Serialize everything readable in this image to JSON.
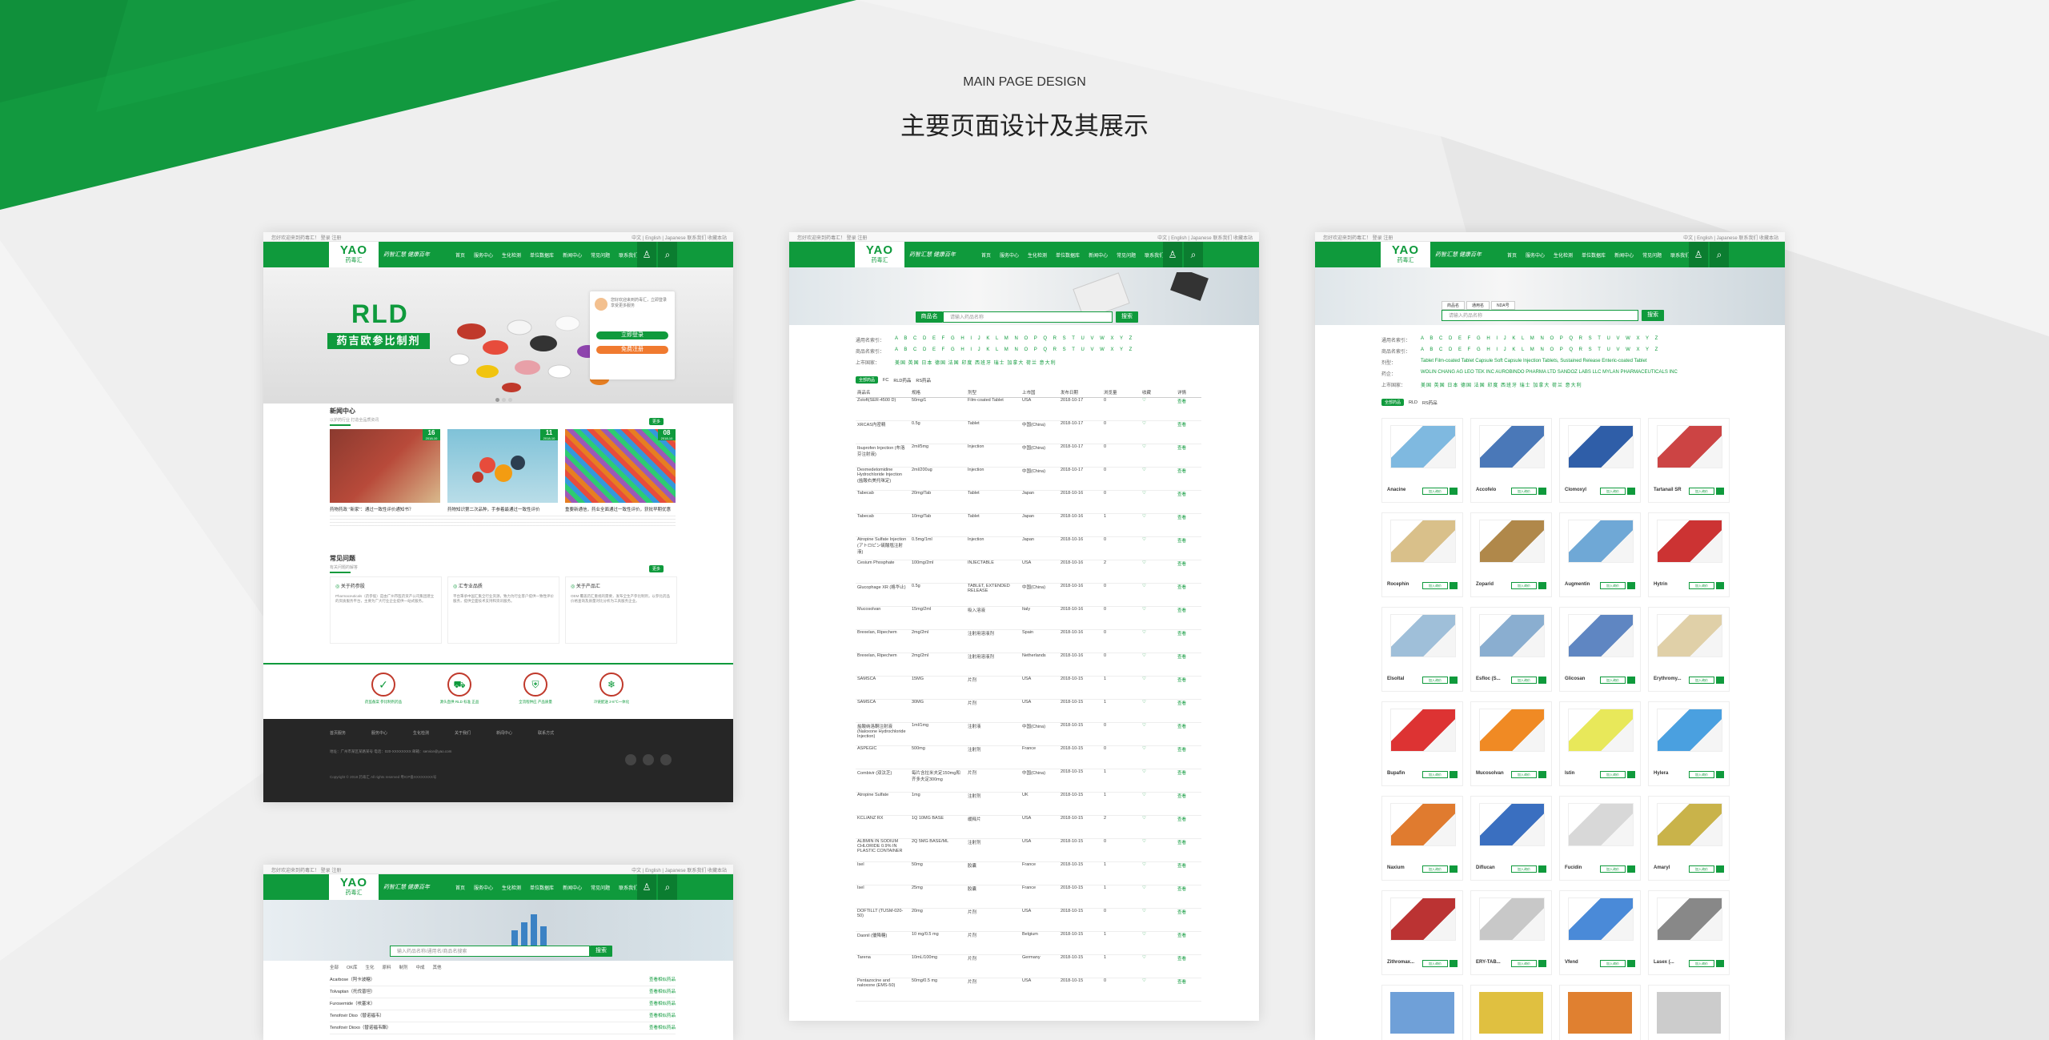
{
  "header": {
    "title_en": "MAIN PAGE DESIGN",
    "title_zh": "主要页面设计及其展示"
  },
  "site": {
    "logo_text": "YAO",
    "logo_sub": "药毒汇",
    "slogan": "药智汇慧 健康百年",
    "topbar_left": "您好欢迎来到药毒汇！ 登录  注册",
    "topbar_right": "中文 | English | Japanese   联系我们   收藏本站",
    "nav_items": [
      "首页",
      "服务中心",
      "生化检测",
      "单位数据库",
      "新闻中心",
      "常见问题",
      "联系我们"
    ],
    "accent": "#0f9a3c",
    "dark_footer": "#262626"
  },
  "home": {
    "banner_title": "RLD",
    "banner_subtitle": "药吉欧参比制剂",
    "login_hint": "您好欢迎来到药毒汇，立即登录享受更多服务",
    "login_btn": "立即登录",
    "register_btn": "免费注册",
    "news_title": "新闻中心",
    "news_sub": "以护药行业  打造全品质资讯",
    "more": "更多",
    "news": [
      {
        "day": "16",
        "date": "2018-10",
        "text": "药物药政 \"新家\"：通过一致性评价通知书？"
      },
      {
        "day": "11",
        "date": "2018-10",
        "text": "药物知识第二次品种，手参着最通过一致性评价"
      },
      {
        "day": "08",
        "date": "2018-10",
        "text": "重要新通信，药业全面通过一致性评价，获批早期优惠"
      }
    ],
    "faq_title": "常见问题",
    "faq_sub": "有关问题的解答",
    "faq": [
      {
        "q": "关于药参股",
        "a": "Pharmaceuticals（药参股）是由广州市医药资产公司集团建立的资质服务平台，主要为广大行业企业提供一站式服务。"
      },
      {
        "q": "汇专业品质",
        "a": "平台秉承中国汇集全行业资源，致力为行业客户提供一致性评价服务，提供全面技术支持和资讯服务。"
      },
      {
        "q": "关于产品汇",
        "a": "OEM 覆盖药汇重视的需要，发布全生产参比制剂，以参比药品价格查询及质量对比分析为工具服务企业。"
      }
    ],
    "features": [
      "药监备案 参比制剂药品",
      "源头直供 RLD 标准 正品",
      "全流程供应 产品质量",
      "冷链配送 2-8℃一体化"
    ],
    "footer_links": [
      "首页服务",
      "服务中心",
      "生化检测",
      "关于我们",
      "新闻中心",
      "联系方式"
    ],
    "footer_info": "地址：广州市某区某路某号  电话：020-XXXXXXXX  邮箱：service@yao.com",
    "footer_copy": "Copyright © 2018 药毒汇 All rights reserved  粤ICP备XXXXXXXX号"
  },
  "search_page": {
    "search_placeholder": "输入药品名称/通用名/商品名搜索",
    "search_btn": "搜索",
    "filter_tabs": [
      "全部",
      "OK库",
      "生化",
      "原料",
      "制剂",
      "中成",
      "其他"
    ],
    "rows": [
      {
        "name": "Acarbose（阿卡波糖）",
        "link": "查看相似药品"
      },
      {
        "name": "Tolvaptan（托伐普坦）",
        "link": "查看相似药品"
      },
      {
        "name": "Furosemide（呋塞米）",
        "link": "查看相似药品"
      },
      {
        "name": "Tenofovir Diso（替诺福韦）",
        "link": "查看相似药品"
      },
      {
        "name": "Tenofovir Dioxo（替诺福韦酯）",
        "link": "查看相似药品"
      }
    ]
  },
  "list_page": {
    "search_select": "商品名",
    "search_placeholder": "请输入药品名称",
    "search_btn": "搜索",
    "filter_labels": [
      "通用名索引：",
      "商品名索引：",
      "上市国家："
    ],
    "alphabet": "A B C D E F G H I J K L M N O P Q R S T U V W X Y Z",
    "countries": "美国 英国 日本 德国 法国 印度 西班牙 瑞士 加拿大 荷兰 意大利",
    "tabs": [
      "全部药品",
      "FC",
      "RLD药品",
      "RS药品"
    ],
    "columns": [
      "商品名",
      "规格",
      "剂型",
      "上市国",
      "发布日期",
      "浏览量",
      "收藏",
      "详情"
    ],
    "rows": [
      [
        "Zoloft(SER-4500 D)",
        "50mg/1",
        "Film-coated Tablet",
        "USA",
        "2018-10-17",
        "0",
        "♡",
        "查看"
      ],
      [
        "XRCAS内密精",
        "0.5g",
        "Tablet",
        "中国(China)",
        "2018-10-17",
        "0",
        "♡",
        "查看"
      ],
      [
        "Ibuprofen Injection (布洛芬注射液)",
        "2ml/5mg",
        "Injection",
        "中国(China)",
        "2018-10-17",
        "0",
        "♡",
        "查看"
      ],
      [
        "Dexmedetomidine Hydrochloride Injection (盐酸右美托咪定)",
        "2ml/200ug",
        "Injection",
        "中国(China)",
        "2018-10-17",
        "0",
        "♡",
        "查看"
      ],
      [
        "Tabecab",
        "20mg/Tab",
        "Tablet",
        "Japan",
        "2018-10-16",
        "0",
        "♡",
        "查看"
      ],
      [
        "Tabecab",
        "10mg/Tab",
        "Tablet",
        "Japan",
        "2018-10-16",
        "1",
        "♡",
        "查看"
      ],
      [
        "Atropine Sulfate Injection (アトロピン硫酸塩注射液)",
        "0.5mg/1ml",
        "Injection",
        "Japan",
        "2018-10-16",
        "0",
        "♡",
        "查看"
      ],
      [
        "Cesium Phosphate",
        "100mg/2ml",
        "INJECTABLE",
        "USA",
        "2018-10-16",
        "2",
        "♡",
        "查看"
      ],
      [
        "Glucophage XR (格华止)",
        "0.5g",
        "TABLET, EXTENDED RELEASE",
        "中国(China)",
        "2018-10-16",
        "0",
        "♡",
        "查看"
      ],
      [
        "Mucosolvan",
        "15mg/2ml",
        "吸入溶液",
        "Italy",
        "2018-10-16",
        "0",
        "♡",
        "查看"
      ],
      [
        "Brexelan, Ripechem",
        "2mg/2ml",
        "注射用溶液剂",
        "Spain",
        "2018-10-16",
        "0",
        "♡",
        "查看"
      ],
      [
        "Brexelan, Ripechem",
        "2mg/2ml",
        "注射用溶液剂",
        "Netherlands",
        "2018-10-16",
        "0",
        "♡",
        "查看"
      ],
      [
        "SAMSCA",
        "15MG",
        "片剂",
        "USA",
        "2018-10-15",
        "1",
        "♡",
        "查看"
      ],
      [
        "SAMSCA",
        "30MG",
        "片剂",
        "USA",
        "2018-10-15",
        "1",
        "♡",
        "查看"
      ],
      [
        "盐酸纳洛酮注射液(Naloxone Hydrochloride Injection)",
        "1ml/1mg",
        "注射液",
        "中国(China)",
        "2018-10-15",
        "0",
        "♡",
        "查看"
      ],
      [
        "ASPEGIC",
        "500mg",
        "注射剂",
        "France",
        "2018-10-15",
        "0",
        "♡",
        "查看"
      ],
      [
        "Combivir (双汰芝)",
        "每片含拉米夫定150mg和齐多夫定300mg",
        "片剂",
        "中国(China)",
        "2018-10-15",
        "1",
        "♡",
        "查看"
      ],
      [
        "Atropine Sulfate",
        "1mg",
        "注射剂",
        "UK",
        "2018-10-15",
        "1",
        "♡",
        "查看"
      ],
      [
        "KCL/ANZ RX",
        "1Q 10MG BASE",
        "缓释片",
        "USA",
        "2018-10-15",
        "2",
        "♡",
        "查看"
      ],
      [
        "ALBMIN IN SODIUM CHLORIDE 0.9% IN PLASTIC CONTAINER",
        "2Q 5MG BASE/ML",
        "注射剂",
        "USA",
        "2018-10-15",
        "0",
        "♡",
        "查看"
      ],
      [
        "Isel",
        "50mg",
        "胶囊",
        "France",
        "2018-10-15",
        "1",
        "♡",
        "查看"
      ],
      [
        "Isel",
        "25mg",
        "胶囊",
        "France",
        "2018-10-15",
        "1",
        "♡",
        "查看"
      ],
      [
        "DOFTILLT (TUSM-020-50)",
        "20mg",
        "片剂",
        "USA",
        "2018-10-15",
        "0",
        "♡",
        "查看"
      ],
      [
        "Daonil (優降糖)",
        "10 mg/0.5 mg",
        "片剂",
        "Belgium",
        "2018-10-15",
        "1",
        "♡",
        "查看"
      ],
      [
        "Tarena",
        "10mL/100mg",
        "片剂",
        "Germany",
        "2018-10-15",
        "1",
        "♡",
        "查看"
      ],
      [
        "Pentazocine and naloxone (EMS-50)",
        "50mg/0.5 mg",
        "片剂",
        "USA",
        "2018-10-15",
        "0",
        "♡",
        "查看"
      ]
    ]
  },
  "product_page": {
    "search_tabs": [
      "商品名",
      "通用名",
      "NDA号"
    ],
    "search_placeholder": "请输入药品名称",
    "search_btn": "搜索",
    "filter_labels": [
      "通用名索引：",
      "商品名索引：",
      "剂型：",
      "药企：",
      "上市国家："
    ],
    "dosage_forms": "Tablet  Film-coated Tablet  Capsule  Soft Capsule  Injection  Tablets, Sustained Release  Enteric-coated Tablet",
    "companies": "WOLIN CHANG AG  LEO TEK INC  AUROBINDO PHARMA LTD  SANDOZ LABS LLC  MYLAN PHARMACEUTICALS INC",
    "tabs": [
      "全部药品",
      "RLD",
      "RS药品"
    ],
    "cart_btn": "加入询价",
    "products": [
      {
        "name": "Anacine"
      },
      {
        "name": "Accofelo"
      },
      {
        "name": "Clomoxyl"
      },
      {
        "name": "Tartanail SR"
      },
      {
        "name": "Rocephin"
      },
      {
        "name": "Zoparid"
      },
      {
        "name": "Augmentin"
      },
      {
        "name": "Hytrin"
      },
      {
        "name": "Elsoltal"
      },
      {
        "name": "Esfloc (S..."
      },
      {
        "name": "Glicosan"
      },
      {
        "name": "Erythromy..."
      },
      {
        "name": "Bupafin"
      },
      {
        "name": "Mucosolvan"
      },
      {
        "name": "Istin"
      },
      {
        "name": "Hylera"
      },
      {
        "name": "Naxium"
      },
      {
        "name": "Diflucan"
      },
      {
        "name": "Fucidin"
      },
      {
        "name": "Amaryl"
      },
      {
        "name": "Zithromax..."
      },
      {
        "name": "ERY-TAB..."
      },
      {
        "name": "Vfend"
      },
      {
        "name": "Lasex (..."
      }
    ]
  }
}
